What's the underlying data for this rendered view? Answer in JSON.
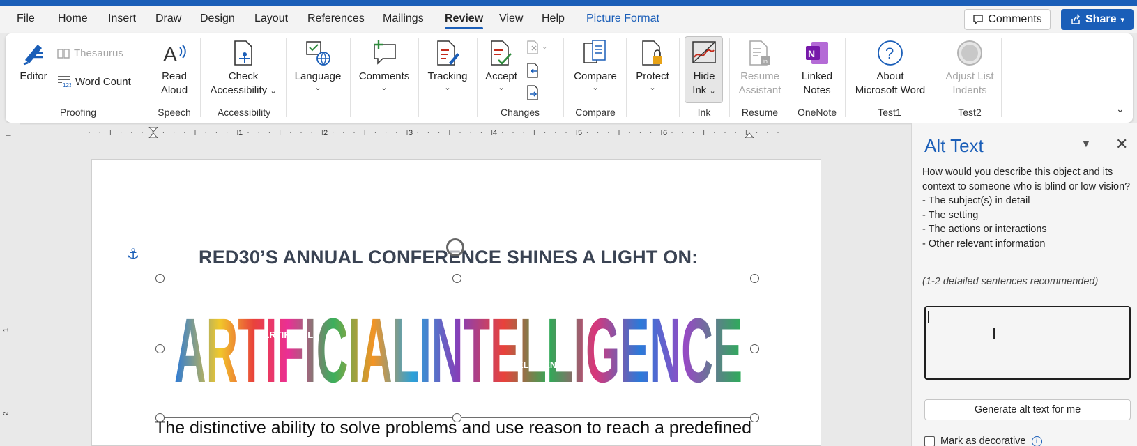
{
  "menu": {
    "tabs": [
      {
        "label": "File"
      },
      {
        "label": "Home"
      },
      {
        "label": "Insert"
      },
      {
        "label": "Draw"
      },
      {
        "label": "Design"
      },
      {
        "label": "Layout"
      },
      {
        "label": "References"
      },
      {
        "label": "Mailings"
      },
      {
        "label": "Review"
      },
      {
        "label": "View"
      },
      {
        "label": "Help"
      },
      {
        "label": "Picture Format"
      }
    ],
    "active_tab": "Review",
    "comments_label": "Comments",
    "share_label": "Share"
  },
  "ribbon": {
    "proofing": {
      "editor": "Editor",
      "thesaurus": "Thesaurus",
      "word_count": "Word Count",
      "label": "Proofing"
    },
    "speech": {
      "read_aloud_1": "Read",
      "read_aloud_2": "Aloud",
      "label": "Speech"
    },
    "accessibility": {
      "check_1": "Check",
      "check_2": "Accessibility",
      "label": "Accessibility"
    },
    "language": {
      "label": "Language"
    },
    "comments": {
      "label": "Comments"
    },
    "tracking": {
      "label": "Tracking"
    },
    "changes": {
      "accept": "Accept",
      "label": "Changes"
    },
    "compare": {
      "compare": "Compare",
      "label": "Compare"
    },
    "protect": {
      "label": "Protect"
    },
    "ink": {
      "hide_1": "Hide",
      "hide_2": "Ink",
      "label": "Ink"
    },
    "resume": {
      "r1": "Resume",
      "r2": "Assistant",
      "label": "Resume"
    },
    "onenote": {
      "l1": "Linked",
      "l2": "Notes",
      "label": "OneNote"
    },
    "test1": {
      "a1": "About",
      "a2": "Microsoft Word",
      "label": "Test1"
    },
    "test2": {
      "a1": "Adjust List",
      "a2": "Indents",
      "label": "Test2"
    }
  },
  "ruler": {
    "numbers": [
      "1",
      "2",
      "3",
      "4",
      "5",
      "6"
    ],
    "vertical_numbers": [
      "1",
      "2"
    ]
  },
  "document": {
    "heading": "RED30’S ANNUAL CONFERENCE SHINES A LIGHT ON:",
    "image_word": "ARTIFICIALINTELLIGENCE",
    "image_small_1": "ARTIFICIAL",
    "image_small_2": "INTELLIGENCE",
    "body": "The distinctive ability to solve problems and use reason to reach a predefined"
  },
  "alt_text_pane": {
    "title": "Alt Text",
    "intro": "How would you describe this object and its context to someone who is blind or low vision?",
    "bullets": [
      "- The subject(s) in detail",
      "- The setting",
      "- The actions or interactions",
      "- Other relevant information"
    ],
    "note": "(1-2 detailed sentences recommended)",
    "input_value": "",
    "generate_label": "Generate alt text for me",
    "decorative_label": "Mark as decorative"
  },
  "colors": {
    "accent": "#1a5eb8",
    "heading": "#3a4353"
  }
}
